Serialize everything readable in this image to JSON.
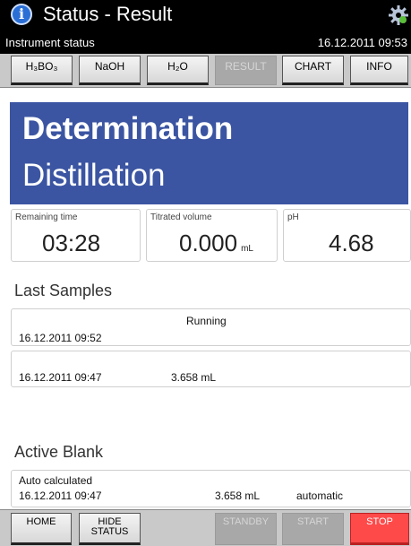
{
  "titlebar": {
    "title": "Status - Result",
    "subtitle": "Instrument status",
    "datetime": "16.12.2011 09:53"
  },
  "tabs": [
    {
      "label": "H₃BO₃",
      "enabled": true
    },
    {
      "label": "NaOH",
      "enabled": true
    },
    {
      "label": "H₂O",
      "enabled": true
    },
    {
      "label": "RESULT",
      "enabled": false
    },
    {
      "label": "CHART",
      "enabled": true
    },
    {
      "label": "INFO",
      "enabled": true
    }
  ],
  "banner": {
    "title": "Determination",
    "subtitle": "Distillation"
  },
  "values": {
    "remaining_time": {
      "label": "Remaining time",
      "value": "03:28"
    },
    "titrated_volume": {
      "label": "Titrated volume",
      "value": "0.000",
      "unit": "mL"
    },
    "ph": {
      "label": "pH",
      "value": "4.68"
    }
  },
  "last_samples": {
    "title": "Last Samples",
    "rows": [
      {
        "status": "Running",
        "datetime": "16.12.2011 09:52",
        "volume": ""
      },
      {
        "status": "",
        "datetime": "16.12.2011 09:47",
        "volume": "3.658 mL"
      }
    ]
  },
  "active_blank": {
    "title": "Active Blank",
    "label": "Auto calculated",
    "datetime": "16.12.2011 09:47",
    "volume": "3.658 mL",
    "mode": "automatic"
  },
  "bottom": {
    "home": "HOME",
    "hide_line1": "HIDE",
    "hide_line2": "STATUS",
    "standby": "STANDBY",
    "start": "START",
    "stop": "STOP"
  },
  "colors": {
    "banner": "#3b55a2",
    "stop": "#ff4a4a"
  }
}
